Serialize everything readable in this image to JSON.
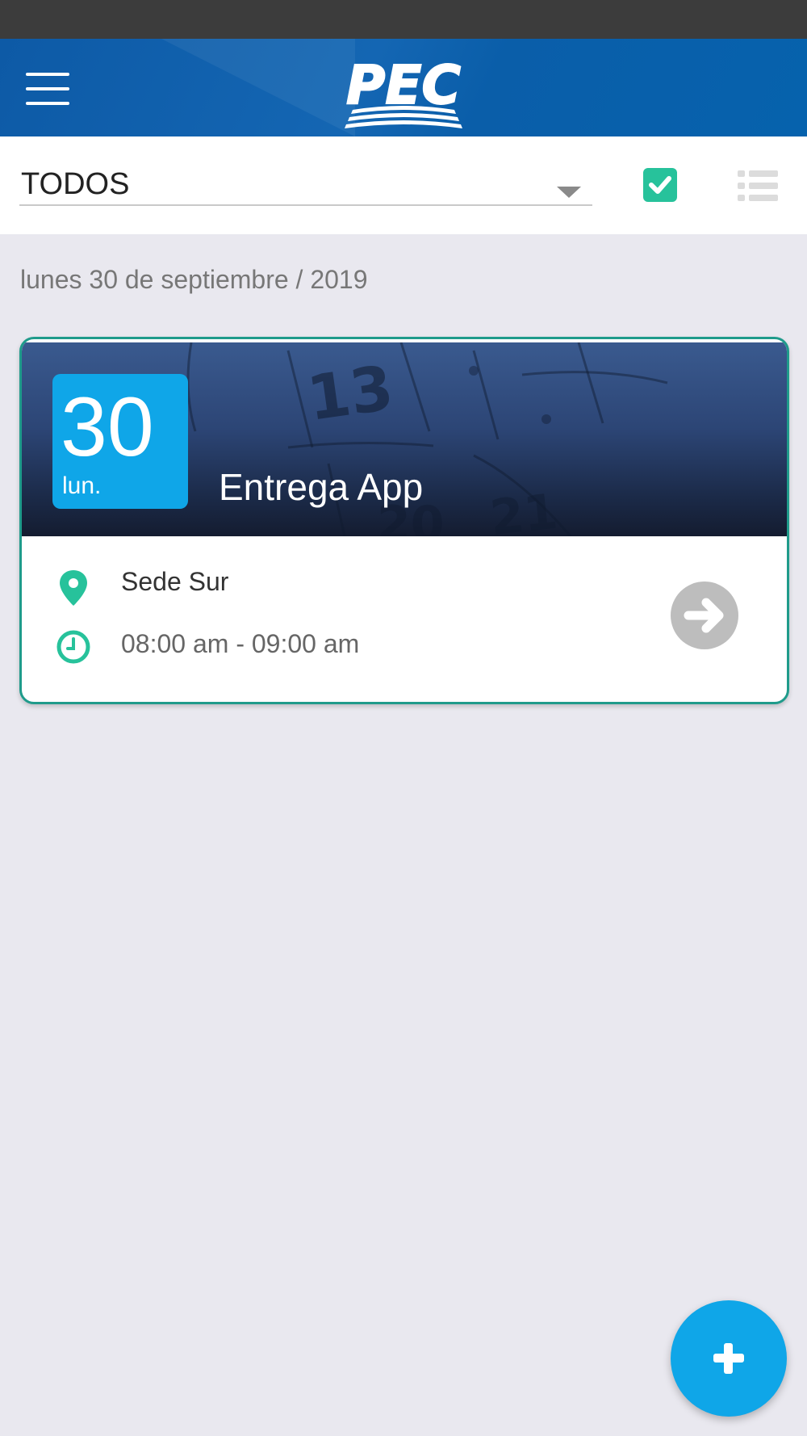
{
  "app": {
    "logo_text": "PEC",
    "brand_color": "#0662ad",
    "accent_color": "#27c29b"
  },
  "filter": {
    "selected": "TODOS"
  },
  "view_toggles": [
    {
      "icon": "check-square-icon",
      "active": true
    },
    {
      "icon": "list-icon",
      "active": false
    }
  ],
  "date_heading": "lunes 30 de septiembre / 2019",
  "events": [
    {
      "day": "30",
      "weekday": "lun.",
      "title": "Entrega App",
      "location": "Sede Sur",
      "time": "08:00 am - 09:00 am",
      "badge_color": "#0fa6e8"
    }
  ],
  "fab": {
    "icon": "plus-icon"
  }
}
